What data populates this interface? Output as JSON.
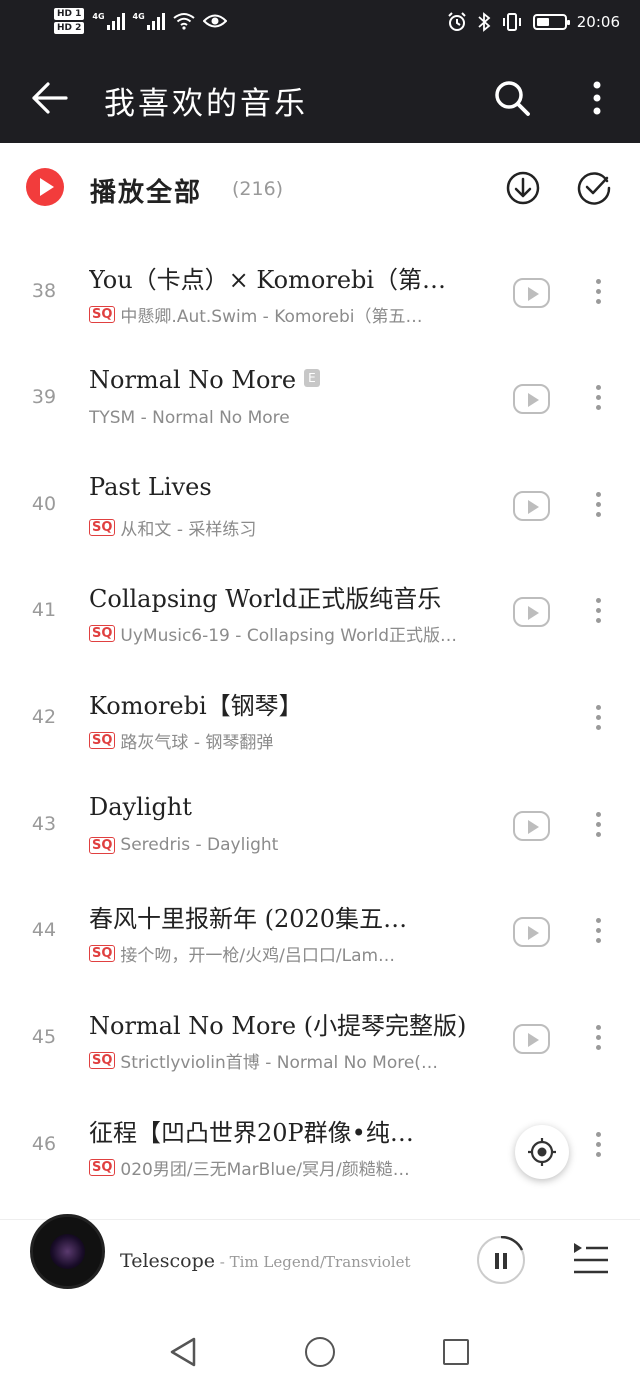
{
  "status_bar": {
    "hd1": "HD 1",
    "hd2": "HD 2",
    "sig1_label": "4G",
    "sig2_label": "4G",
    "time": "20:06"
  },
  "header": {
    "title": "我喜欢的音乐",
    "back_icon": "back-arrow-icon",
    "search_icon": "search-icon",
    "more_icon": "more-vertical-icon"
  },
  "toolbar": {
    "play_all_label": "播放全部",
    "count": "(216)",
    "download_icon": "download-icon",
    "multi_select_icon": "check-circle-icon"
  },
  "songs": [
    {
      "num": "38",
      "title": "You（卡点）× Komorebi（第…",
      "sq": "SQ",
      "sub": "中懸卿.Aut.Swim - Komorebi（第五…"
    },
    {
      "num": "39",
      "title": "Normal No More",
      "badge": "E",
      "sq": "",
      "sub": "TYSM - Normal No More"
    },
    {
      "num": "40",
      "title": "Past Lives",
      "sq": "SQ",
      "sub": "从和文 - 采样练习"
    },
    {
      "num": "41",
      "title": "Collapsing World正式版纯音乐",
      "sq": "SQ",
      "sub": "UyMusic6-19 - Collapsing World正式版…"
    },
    {
      "num": "42",
      "title": "Komorebi【钢琴】",
      "sq": "SQ",
      "sub": "路灰气球 - 钢琴翻弹"
    },
    {
      "num": "43",
      "title": "Daylight",
      "sq": "SQ",
      "sub": "Seredris - Daylight"
    },
    {
      "num": "44",
      "title": "春风十里报新年 (2020集五…",
      "sq": "SQ",
      "sub": "接个吻，开一枪/火鸡/吕口口/Lam…"
    },
    {
      "num": "45",
      "title": "Normal No More (小提琴完整版)",
      "sq": "SQ",
      "sub": "Strictlyviolin首博 - Normal No More(…"
    },
    {
      "num": "46",
      "title": "征程【凹凸世界20P群像•纯…",
      "sq": "SQ",
      "sub": "020男团/三无MarBlue/冥月/颜糙糙…"
    }
  ],
  "player": {
    "title": "Telescope",
    "artist": " - Tim Legend/Transviolet",
    "pause_icon": "pause-icon",
    "playlist_icon": "playlist-icon"
  },
  "nav": {
    "back_icon": "nav-back-icon",
    "home_icon": "nav-home-icon",
    "recent_icon": "nav-recent-icon"
  },
  "colors": {
    "header_bg": "#1e1e22",
    "accent_red": "#f23c3c"
  }
}
